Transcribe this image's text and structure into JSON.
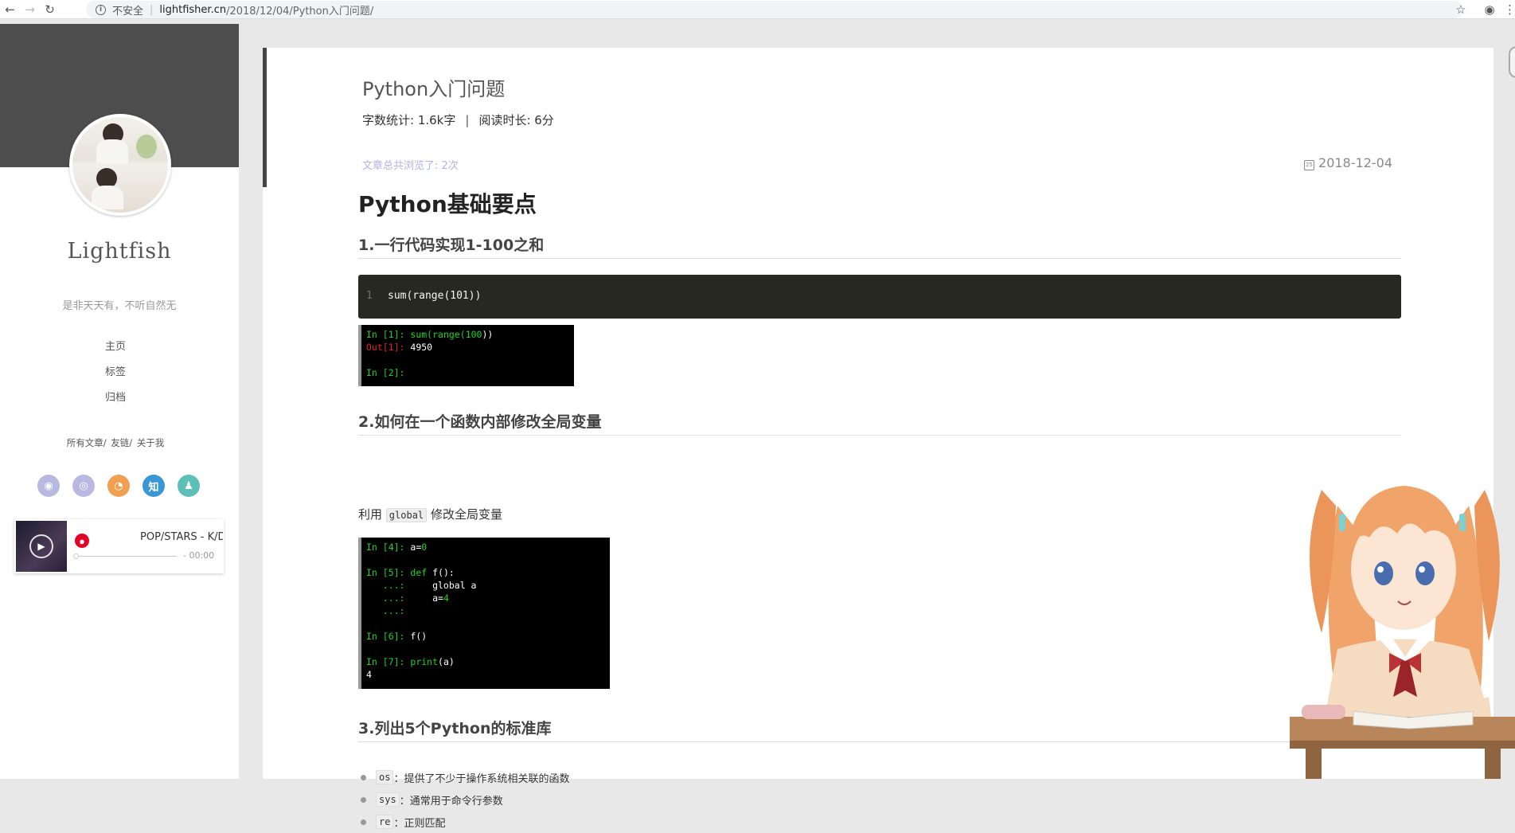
{
  "browser": {
    "security_label": "不安全",
    "url_host": "lightfisher.cn",
    "url_path": "/2018/12/04/Python入门问题/"
  },
  "sidebar": {
    "site_name": "Lightfish",
    "tagline": "是非天天有，不听自然无",
    "nav": [
      {
        "label": "主页"
      },
      {
        "label": "标签"
      },
      {
        "label": "归档"
      }
    ],
    "sub_nav": [
      "所有文章/",
      "友链/",
      "关于我"
    ],
    "social": [
      {
        "icon": "github-icon",
        "glyph": "◉",
        "color": "#b8b8e0"
      },
      {
        "icon": "weibo-icon",
        "glyph": "◎",
        "color": "#b8b8e0"
      },
      {
        "icon": "rss-icon",
        "glyph": "◔",
        "color": "#f0a050"
      },
      {
        "icon": "zhihu-icon",
        "glyph": "知",
        "color": "#3a97d6"
      },
      {
        "icon": "qq-icon",
        "glyph": "♟",
        "color": "#5cc0b8"
      }
    ]
  },
  "player": {
    "title": "POP/STARS - K/DA",
    "time": "- 00:00",
    "progress": 0
  },
  "post": {
    "title": "Python入门问题",
    "word_count": "字数统计: 1.6k字",
    "read_time": "阅读时长: 6分",
    "separator": "|",
    "views": "文章总共浏览了: 2次",
    "date": "2018-12-04",
    "h1": "Python基础要点",
    "sections": [
      {
        "heading": "1.一行代码实现1-100之和"
      },
      {
        "heading": "2.如何在一个函数内部修改全局变量"
      },
      {
        "heading": "3.列出5个Python的标准库"
      }
    ],
    "code_line_no": "1",
    "code_line": "sum(range(101))",
    "para_prefix": "利用",
    "para_code": "global",
    "para_suffix": "修改全局变量",
    "libs": [
      {
        "code": "os",
        "desc": "：提供了不少于操作系统相关联的函数"
      },
      {
        "code": "sys",
        "desc": "：通常用于命令行参数"
      },
      {
        "code": "re",
        "desc": "：正则匹配"
      }
    ]
  },
  "term1": {
    "l1_prompt": "In [1]:",
    "l1_fn": "sum(",
    "l1_range": "range(",
    "l1_num": "100",
    "l1_close": "))",
    "l2_prompt": "Out[1]:",
    "l2_val": "4950",
    "l3_prompt": "In [2]:"
  },
  "term2": {
    "l1_prompt": "In [4]:",
    "l1_code": "a=",
    "l1_num": "0",
    "l2_prompt": "In [5]:",
    "l2_kw": "def",
    "l2_fn": "f",
    "l2_rest": "():",
    "l3_cont": "   ...:",
    "l3_code": "     global a",
    "l4_cont": "   ...:",
    "l4_code": "     a=",
    "l4_num": "4",
    "l5_cont": "   ...:",
    "l6_prompt": "In [6]:",
    "l6_code": "f()",
    "l7_prompt": "In [7]:",
    "l7_fn": "print",
    "l7_rest": "(a)",
    "l8_out": "4"
  }
}
